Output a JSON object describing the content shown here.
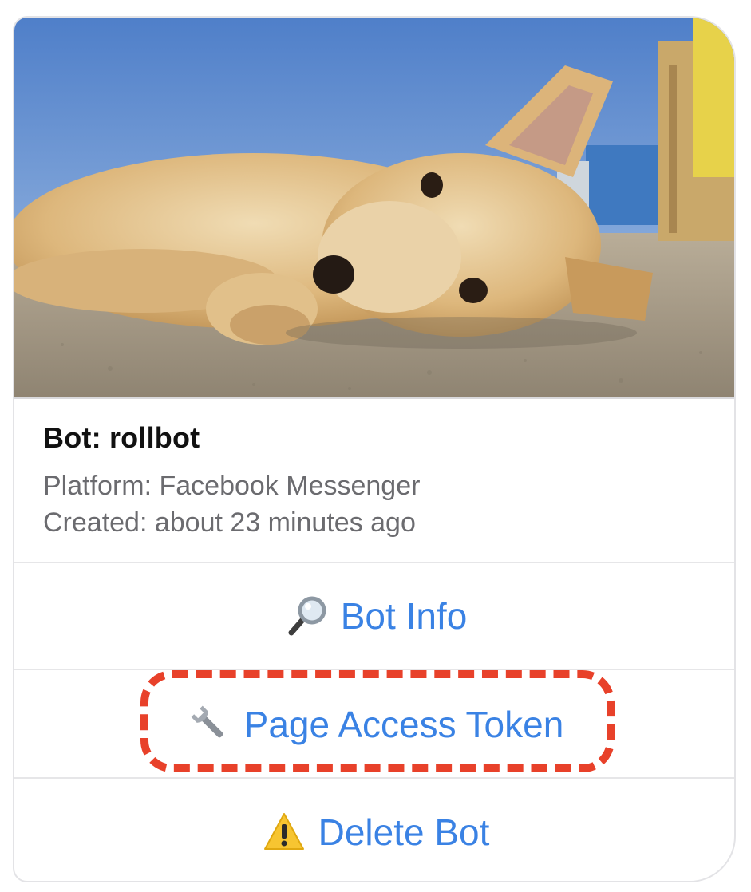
{
  "card": {
    "image": {
      "subject": "puppy-lying-on-ground"
    },
    "title": "Bot: rollbot",
    "platform": "Platform: Facebook Messenger",
    "created": "Created: about 23 minutes ago"
  },
  "actions": [
    {
      "label": "Bot Info",
      "icon": "magnifier-icon"
    },
    {
      "label": "Page Access Token",
      "icon": "wrench-icon"
    },
    {
      "label": "Delete Bot",
      "icon": "warning-icon"
    }
  ],
  "annotation": {
    "style": "dashed",
    "color": "#e8412a",
    "target": "Page Access Token"
  },
  "colors": {
    "link": "#3a82e4",
    "title": "#111111",
    "subtext": "#6b6b6f",
    "border": "#e3e3e6"
  }
}
